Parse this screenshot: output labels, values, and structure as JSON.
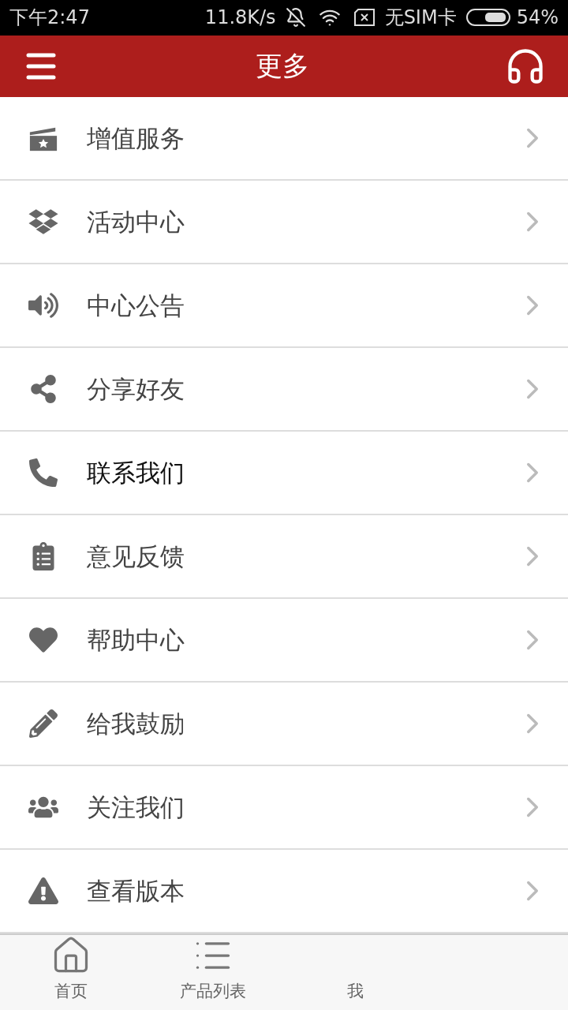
{
  "status_bar": {
    "time": "下午2:47",
    "speed": "11.8K/s",
    "sim": "无SIM卡",
    "battery": "54%"
  },
  "header": {
    "title": "更多"
  },
  "menu": [
    {
      "label": "增值服务",
      "selected": false
    },
    {
      "label": "活动中心",
      "selected": false
    },
    {
      "label": "中心公告",
      "selected": false
    },
    {
      "label": "分享好友",
      "selected": false
    },
    {
      "label": "联系我们",
      "selected": true
    },
    {
      "label": "意见反馈",
      "selected": false
    },
    {
      "label": "帮助中心",
      "selected": false
    },
    {
      "label": "给我鼓励",
      "selected": false
    },
    {
      "label": "关注我们",
      "selected": false
    },
    {
      "label": "查看版本",
      "selected": false
    }
  ],
  "tab_bar": [
    {
      "label": "首页"
    },
    {
      "label": "产品列表"
    },
    {
      "label": "我"
    }
  ]
}
